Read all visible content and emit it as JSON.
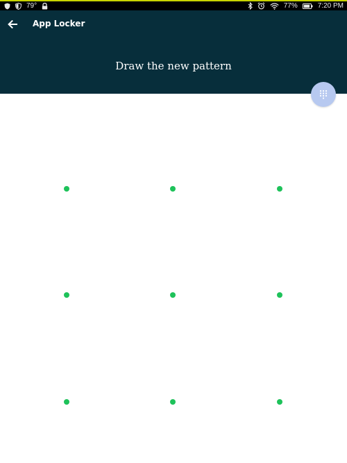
{
  "status_bar": {
    "temperature": "79°",
    "battery_percent": "77%",
    "time": "7:20 PM",
    "icons": [
      "shield-icon",
      "shield-check-icon",
      "lock-icon",
      "bluetooth-icon",
      "alarm-icon",
      "wifi-icon",
      "battery-icon"
    ]
  },
  "app_bar": {
    "title": "App Locker",
    "prompt": "Draw the new pattern",
    "background": "#072e3b"
  },
  "fab": {
    "icon": "dialpad-icon",
    "color": "#b7c9f0"
  },
  "pattern": {
    "rows": 3,
    "cols": 3,
    "dot_color": "#1ec25a"
  }
}
